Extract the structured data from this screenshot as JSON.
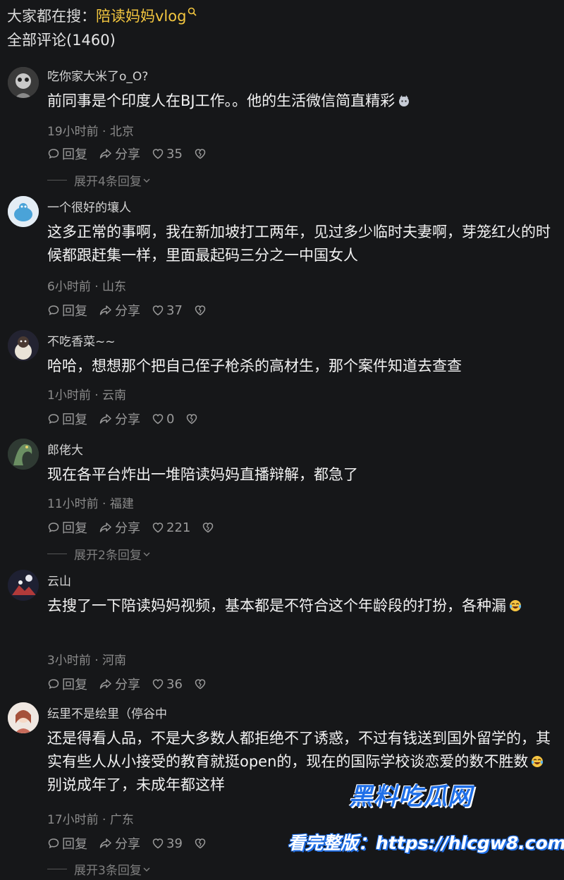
{
  "header": {
    "search_prefix": "大家都在搜：",
    "search_term": "陪读妈妈vlog",
    "comment_count_label": "全部评论(1460)"
  },
  "colors": {
    "accent": "#f3c63f",
    "background": "#161719",
    "watermark": "#1f6fe8"
  },
  "comments": [
    {
      "name": "吃你家大米了o_O?",
      "text": "前同事是个印度人在BJ工作。。他的生活微信简直精彩",
      "emoji": "cat-emoji",
      "meta": "19小时前 · 北京",
      "reply": "回复",
      "share": "分享",
      "likes": "35",
      "expand": "展开4条回复"
    },
    {
      "name": "一个很好的壤人",
      "text": "这多正常的事啊，我在新加坡打工两年，见过多少临时夫妻啊，芽笼红火的时候都跟赶集一样，里面最起码三分之一中国女人",
      "meta": "6小时前 · 山东",
      "reply": "回复",
      "share": "分享",
      "likes": "37"
    },
    {
      "name": "不吃香菜~~",
      "text": "哈哈，想想那个把自己侄子枪杀的高材生，那个案件知道去查查",
      "meta": "1小时前 · 云南",
      "reply": "回复",
      "share": "分享",
      "likes": "0"
    },
    {
      "name": "郎佬大",
      "text": "现在各平台炸出一堆陪读妈妈直播辩解，都急了",
      "meta": "11小时前 · 福建",
      "reply": "回复",
      "share": "分享",
      "likes": "221",
      "expand": "展开2条回复"
    },
    {
      "name": "云山",
      "text": "去搜了一下陪读妈妈视频，基本都是不符合这个年龄段的打扮，各种漏",
      "emoji": "laugh-cry-emoji",
      "meta": "3小时前 · 河南",
      "reply": "回复",
      "share": "分享",
      "likes": "36"
    },
    {
      "name": "纭里不是绘里（停谷中",
      "text_a": "还是得看人品，不是大多数人都拒绝不了诱惑，不过有钱送到国外留学的，其实有些人从小接受的教育就挺open的，现在的国际学校谈恋爱的数不胜数",
      "text_b": "别说成年了，未成年都这样",
      "emoji": "laugh-cry-emoji",
      "meta": "17小时前 · 广东",
      "reply": "回复",
      "share": "分享",
      "likes": "39",
      "expand": "展开3条回复"
    }
  ],
  "watermark": {
    "title": "黑料吃瓜网",
    "url": "看完整版：https://hlcgw8.com"
  }
}
